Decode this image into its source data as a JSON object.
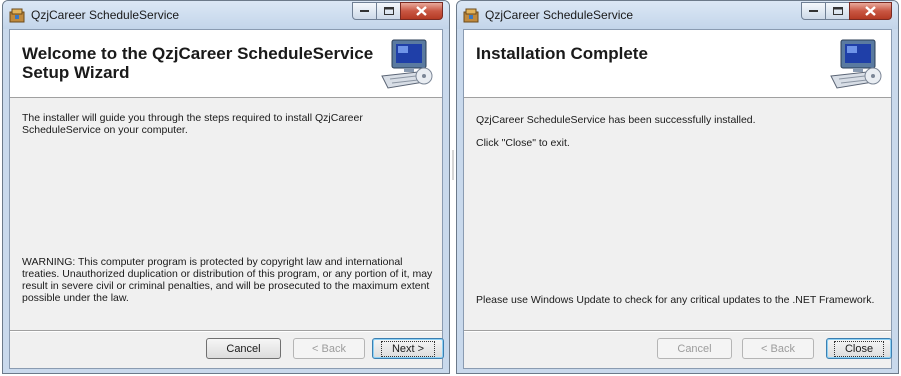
{
  "left_window": {
    "title": "QzjCareer ScheduleService",
    "banner_title": "Welcome to the QzjCareer ScheduleService Setup Wizard",
    "intro_text": "The installer will guide you through the steps required to install QzjCareer ScheduleService on your computer.",
    "warning_text": "WARNING: This computer program is protected by copyright law and international treaties. Unauthorized duplication or distribution of this program, or any portion of it, may result in severe civil or criminal penalties, and will be prosecuted to the maximum extent possible under the law.",
    "buttons": {
      "cancel": "Cancel",
      "back": "< Back",
      "next": "Next >"
    }
  },
  "right_window": {
    "title": "QzjCareer ScheduleService",
    "banner_title": "Installation Complete",
    "success_text": "QzjCareer ScheduleService has been successfully installed.",
    "exit_text": "Click \"Close\" to exit.",
    "update_text": "Please use Windows Update to check for any critical updates to the .NET Framework.",
    "buttons": {
      "cancel": "Cancel",
      "back": "< Back",
      "close": "Close"
    }
  },
  "icons": {
    "app_icon": "installer-package-icon",
    "banner_icon": "computer-setup-icon",
    "minimize": "minimize-icon",
    "maximize": "maximize-icon",
    "close": "close-icon"
  },
  "colors": {
    "frame": "#c9d9ec",
    "client": "#f0f0f0",
    "close_button": "#c95743"
  }
}
